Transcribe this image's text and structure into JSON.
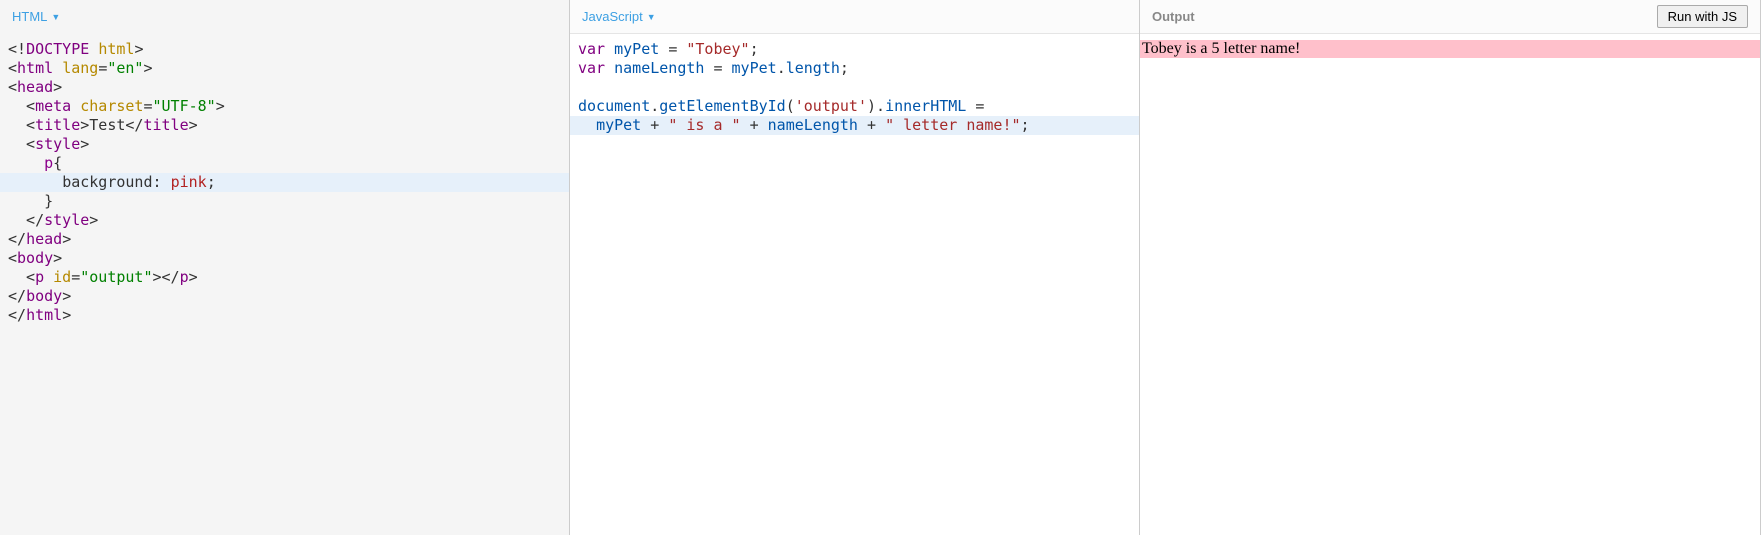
{
  "panels": {
    "html": {
      "label": "HTML",
      "code_lines": [
        {
          "hl": false,
          "tokens": [
            [
              "c-plain",
              "<!"
            ],
            [
              "c-tag",
              "DOCTYPE"
            ],
            [
              "c-plain",
              " "
            ],
            [
              "c-attr",
              "html"
            ],
            [
              "c-plain",
              ">"
            ]
          ]
        },
        {
          "hl": false,
          "tokens": [
            [
              "c-plain",
              "<"
            ],
            [
              "c-tag",
              "html"
            ],
            [
              "c-plain",
              " "
            ],
            [
              "c-attr",
              "lang"
            ],
            [
              "c-plain",
              "="
            ],
            [
              "c-str",
              "\"en\""
            ],
            [
              "c-plain",
              ">"
            ]
          ]
        },
        {
          "hl": false,
          "tokens": [
            [
              "c-plain",
              "<"
            ],
            [
              "c-tag",
              "head"
            ],
            [
              "c-plain",
              ">"
            ]
          ]
        },
        {
          "hl": false,
          "tokens": [
            [
              "c-plain",
              "  <"
            ],
            [
              "c-tag",
              "meta"
            ],
            [
              "c-plain",
              " "
            ],
            [
              "c-attr",
              "charset"
            ],
            [
              "c-plain",
              "="
            ],
            [
              "c-str",
              "\"UTF-8\""
            ],
            [
              "c-plain",
              ">"
            ]
          ]
        },
        {
          "hl": false,
          "tokens": [
            [
              "c-plain",
              "  <"
            ],
            [
              "c-tag",
              "title"
            ],
            [
              "c-plain",
              ">"
            ],
            [
              "c-dark",
              "Test"
            ],
            [
              "c-plain",
              "</"
            ],
            [
              "c-tag",
              "title"
            ],
            [
              "c-plain",
              ">"
            ]
          ]
        },
        {
          "hl": false,
          "tokens": [
            [
              "c-plain",
              "  <"
            ],
            [
              "c-tag",
              "style"
            ],
            [
              "c-plain",
              ">"
            ]
          ]
        },
        {
          "hl": false,
          "tokens": [
            [
              "c-plain",
              "    "
            ],
            [
              "c-sel",
              "p"
            ],
            [
              "c-plain",
              "{"
            ]
          ]
        },
        {
          "hl": true,
          "tokens": [
            [
              "c-plain",
              "      "
            ],
            [
              "c-prop",
              "background"
            ],
            [
              "c-plain",
              ": "
            ],
            [
              "c-val",
              "pink"
            ],
            [
              "c-plain",
              ";"
            ]
          ]
        },
        {
          "hl": false,
          "tokens": [
            [
              "c-plain",
              "    }"
            ]
          ]
        },
        {
          "hl": false,
          "tokens": [
            [
              "c-plain",
              "  </"
            ],
            [
              "c-tag",
              "style"
            ],
            [
              "c-plain",
              ">"
            ]
          ]
        },
        {
          "hl": false,
          "tokens": [
            [
              "c-plain",
              "</"
            ],
            [
              "c-tag",
              "head"
            ],
            [
              "c-plain",
              ">"
            ]
          ]
        },
        {
          "hl": false,
          "tokens": [
            [
              "c-plain",
              "<"
            ],
            [
              "c-tag",
              "body"
            ],
            [
              "c-plain",
              ">"
            ]
          ]
        },
        {
          "hl": false,
          "tokens": [
            [
              "c-plain",
              "  <"
            ],
            [
              "c-tag",
              "p"
            ],
            [
              "c-plain",
              " "
            ],
            [
              "c-attr",
              "id"
            ],
            [
              "c-plain",
              "="
            ],
            [
              "c-str",
              "\"output\""
            ],
            [
              "c-plain",
              "></"
            ],
            [
              "c-tag",
              "p"
            ],
            [
              "c-plain",
              ">"
            ]
          ]
        },
        {
          "hl": false,
          "tokens": [
            [
              "c-plain",
              "</"
            ],
            [
              "c-tag",
              "body"
            ],
            [
              "c-plain",
              ">"
            ]
          ]
        },
        {
          "hl": false,
          "tokens": [
            [
              "c-plain",
              "</"
            ],
            [
              "c-tag",
              "html"
            ],
            [
              "c-plain",
              ">"
            ]
          ]
        }
      ]
    },
    "js": {
      "label": "JavaScript",
      "code_lines": [
        {
          "hl": false,
          "tokens": [
            [
              "c-kw",
              "var"
            ],
            [
              "c-plain",
              " "
            ],
            [
              "c-id",
              "myPet"
            ],
            [
              "c-plain",
              " "
            ],
            [
              "c-op",
              "="
            ],
            [
              "c-plain",
              " "
            ],
            [
              "c-brown",
              "\"Tobey\""
            ],
            [
              "c-plain",
              ";"
            ]
          ]
        },
        {
          "hl": false,
          "tokens": [
            [
              "c-kw",
              "var"
            ],
            [
              "c-plain",
              " "
            ],
            [
              "c-id",
              "nameLength"
            ],
            [
              "c-plain",
              " "
            ],
            [
              "c-op",
              "="
            ],
            [
              "c-plain",
              " "
            ],
            [
              "c-id",
              "myPet"
            ],
            [
              "c-plain",
              "."
            ],
            [
              "c-id",
              "length"
            ],
            [
              "c-plain",
              ";"
            ]
          ]
        },
        {
          "hl": false,
          "tokens": [
            [
              "c-plain",
              " "
            ]
          ]
        },
        {
          "hl": false,
          "tokens": [
            [
              "c-id",
              "document"
            ],
            [
              "c-plain",
              "."
            ],
            [
              "c-id",
              "getElementById"
            ],
            [
              "c-plain",
              "("
            ],
            [
              "c-brown",
              "'output'"
            ],
            [
              "c-plain",
              ")."
            ],
            [
              "c-id",
              "innerHTML"
            ],
            [
              "c-plain",
              " "
            ],
            [
              "c-op",
              "="
            ],
            [
              "c-plain",
              " "
            ]
          ]
        },
        {
          "hl": true,
          "tokens": [
            [
              "c-plain",
              "  "
            ],
            [
              "c-id",
              "myPet"
            ],
            [
              "c-plain",
              " "
            ],
            [
              "c-op",
              "+"
            ],
            [
              "c-plain",
              " "
            ],
            [
              "c-brown",
              "\" is a \""
            ],
            [
              "c-plain",
              " "
            ],
            [
              "c-op",
              "+"
            ],
            [
              "c-plain",
              " "
            ],
            [
              "c-id",
              "nameLength"
            ],
            [
              "c-plain",
              " "
            ],
            [
              "c-op",
              "+"
            ],
            [
              "c-plain",
              " "
            ],
            [
              "c-brown",
              "\" letter name!\""
            ],
            [
              "c-plain",
              ";"
            ]
          ]
        }
      ]
    },
    "output": {
      "label": "Output",
      "run_button_label": "Run with JS",
      "result_text": "Tobey is a 5 letter name!"
    }
  }
}
